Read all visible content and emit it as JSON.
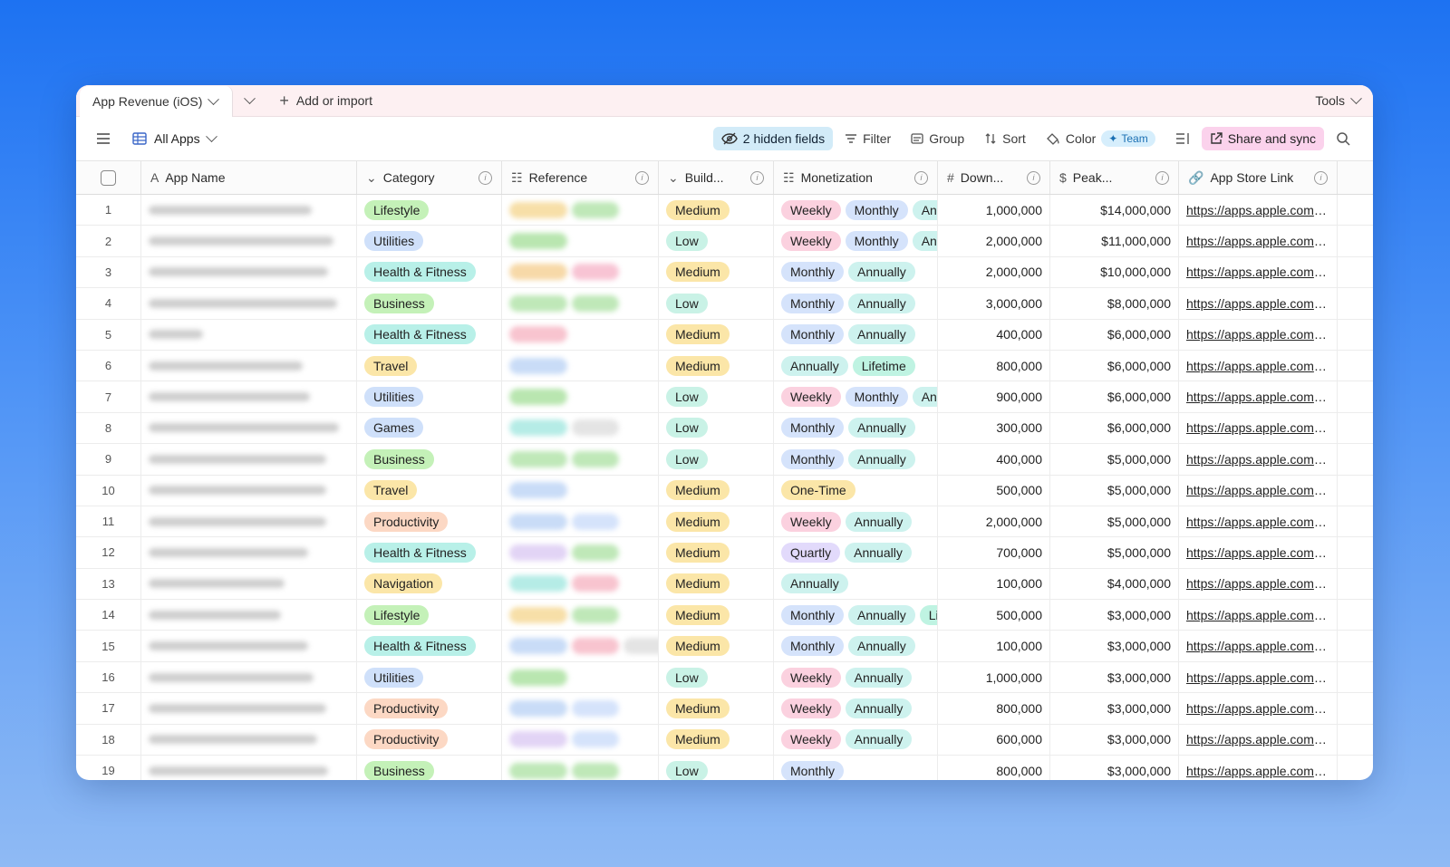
{
  "topbar": {
    "base_name": "App Revenue (iOS)",
    "add_label": "Add or import",
    "tools_label": "Tools"
  },
  "toolbar": {
    "view_name": "All Apps",
    "hidden_fields": "2 hidden fields",
    "filter": "Filter",
    "group": "Group",
    "sort": "Sort",
    "color": "Color",
    "team_badge": "Team",
    "share": "Share and sync"
  },
  "columns": [
    {
      "label": "App Name",
      "icon": "text-field-icon"
    },
    {
      "label": "Category",
      "icon": "single-select-icon"
    },
    {
      "label": "Reference",
      "icon": "linked-record-icon"
    },
    {
      "label": "Build...",
      "icon": "single-select-icon"
    },
    {
      "label": "Monetization",
      "icon": "multi-select-icon"
    },
    {
      "label": "Down...",
      "icon": "number-icon"
    },
    {
      "label": "Peak...",
      "icon": "currency-icon"
    },
    {
      "label": "App Store Link",
      "icon": "link-icon"
    }
  ],
  "colors": {
    "category": {
      "Lifestyle": "#c4f1b8",
      "Utilities": "#cfe0fa",
      "Health & Fitness": "#b8f0e8",
      "Business": "#c4f1b8",
      "Travel": "#fbe6a8",
      "Games": "#cfe0fa",
      "Productivity": "#fcd8c4",
      "Navigation": "#fbe6a8"
    },
    "build": {
      "Medium": "#fbe6a8",
      "Low": "#c9f2e6"
    },
    "monetization": {
      "Weekly": "#fbd1df",
      "Monthly": "#d5e3fb",
      "Annually": "#cdf2ee",
      "Lifetime": "#bff3e2",
      "One-Time": "#fbe6a8",
      "Quartly": "#e2dafb",
      "Ann": "#cdf2ee",
      "Li": "#bff3e2"
    }
  },
  "rows": [
    {
      "n": "1",
      "category": "Lifestyle",
      "build": "Medium",
      "monetization": [
        "Weekly",
        "Monthly",
        "Ann"
      ],
      "downloads": "1,000,000",
      "peak": "$14,000,000",
      "link": "https://apps.apple.com/U...",
      "ref": [
        "#f7dfa8",
        "#bfe8b8"
      ]
    },
    {
      "n": "2",
      "category": "Utilities",
      "build": "Low",
      "monetization": [
        "Weekly",
        "Monthly",
        "Ann"
      ],
      "downloads": "2,000,000",
      "peak": "$11,000,000",
      "link": "https://apps.apple.com/U...",
      "ref": [
        "#b9e6b0"
      ]
    },
    {
      "n": "3",
      "category": "Health & Fitness",
      "build": "Medium",
      "monetization": [
        "Monthly",
        "Annually"
      ],
      "downloads": "2,000,000",
      "peak": "$10,000,000",
      "link": "https://apps.apple.com/U...",
      "ref": [
        "#f7d9a8",
        "#f8c4d4"
      ]
    },
    {
      "n": "4",
      "category": "Business",
      "build": "Low",
      "monetization": [
        "Monthly",
        "Annually"
      ],
      "downloads": "3,000,000",
      "peak": "$8,000,000",
      "link": "https://apps.apple.com/U...",
      "ref": [
        "#bfe8b8",
        "#bfe8b8"
      ]
    },
    {
      "n": "5",
      "category": "Health & Fitness",
      "build": "Medium",
      "monetization": [
        "Monthly",
        "Annually"
      ],
      "downloads": "400,000",
      "peak": "$6,000,000",
      "link": "https://apps.apple.com/U...",
      "ref": [
        "#f8c4cf"
      ]
    },
    {
      "n": "6",
      "category": "Travel",
      "build": "Medium",
      "monetization": [
        "Annually",
        "Lifetime"
      ],
      "downloads": "800,000",
      "peak": "$6,000,000",
      "link": "https://apps.apple.com/U...",
      "ref": [
        "#c9dcf7"
      ]
    },
    {
      "n": "7",
      "category": "Utilities",
      "build": "Low",
      "monetization": [
        "Weekly",
        "Monthly",
        "Ann"
      ],
      "downloads": "900,000",
      "peak": "$6,000,000",
      "link": "https://apps.apple.com/U...",
      "ref": [
        "#b9e6b0"
      ]
    },
    {
      "n": "8",
      "category": "Games",
      "build": "Low",
      "monetization": [
        "Monthly",
        "Annually"
      ],
      "downloads": "300,000",
      "peak": "$6,000,000",
      "link": "https://apps.apple.com/U...",
      "ref": [
        "#b5ece6",
        "#e4e4e4"
      ]
    },
    {
      "n": "9",
      "category": "Business",
      "build": "Low",
      "monetization": [
        "Monthly",
        "Annually"
      ],
      "downloads": "400,000",
      "peak": "$5,000,000",
      "link": "https://apps.apple.com/U...",
      "ref": [
        "#bfe8b8",
        "#bfe8b8"
      ]
    },
    {
      "n": "10",
      "category": "Travel",
      "build": "Medium",
      "monetization": [
        "One-Time"
      ],
      "downloads": "500,000",
      "peak": "$5,000,000",
      "link": "https://apps.apple.com/U...",
      "ref": [
        "#c9dcf7"
      ]
    },
    {
      "n": "11",
      "category": "Productivity",
      "build": "Medium",
      "monetization": [
        "Weekly",
        "Annually"
      ],
      "downloads": "2,000,000",
      "peak": "$5,000,000",
      "link": "https://apps.apple.com/U...",
      "ref": [
        "#c9dcf7",
        "#d5e3fb"
      ]
    },
    {
      "n": "12",
      "category": "Health & Fitness",
      "build": "Medium",
      "monetization": [
        "Quartly",
        "Annually"
      ],
      "downloads": "700,000",
      "peak": "$5,000,000",
      "link": "https://apps.apple.com/D...",
      "ref": [
        "#e2d4f5",
        "#bfe8b8"
      ]
    },
    {
      "n": "13",
      "category": "Navigation",
      "build": "Medium",
      "monetization": [
        "Annually"
      ],
      "downloads": "100,000",
      "peak": "$4,000,000",
      "link": "https://apps.apple.com/U...",
      "ref": [
        "#b5ece6",
        "#f8c4cf"
      ]
    },
    {
      "n": "14",
      "category": "Lifestyle",
      "build": "Medium",
      "monetization": [
        "Monthly",
        "Annually",
        "Li"
      ],
      "downloads": "500,000",
      "peak": "$3,000,000",
      "link": "https://apps.apple.com/U...",
      "ref": [
        "#f7dfa8",
        "#bfe8b8"
      ]
    },
    {
      "n": "15",
      "category": "Health & Fitness",
      "build": "Medium",
      "monetization": [
        "Monthly",
        "Annually"
      ],
      "downloads": "100,000",
      "peak": "$3,000,000",
      "link": "https://apps.apple.com/U...",
      "ref": [
        "#c9dcf7",
        "#f8c4cf",
        "#e4e4e4"
      ]
    },
    {
      "n": "16",
      "category": "Utilities",
      "build": "Low",
      "monetization": [
        "Weekly",
        "Annually"
      ],
      "downloads": "1,000,000",
      "peak": "$3,000,000",
      "link": "https://apps.apple.com/U...",
      "ref": [
        "#b9e6b0"
      ]
    },
    {
      "n": "17",
      "category": "Productivity",
      "build": "Medium",
      "monetization": [
        "Weekly",
        "Annually"
      ],
      "downloads": "800,000",
      "peak": "$3,000,000",
      "link": "https://apps.apple.com/U...",
      "ref": [
        "#c9dcf7",
        "#d5e3fb"
      ]
    },
    {
      "n": "18",
      "category": "Productivity",
      "build": "Medium",
      "monetization": [
        "Weekly",
        "Annually"
      ],
      "downloads": "600,000",
      "peak": "$3,000,000",
      "link": "https://apps.apple.com/U...",
      "ref": [
        "#e2d4f5",
        "#d5e3fb"
      ]
    },
    {
      "n": "19",
      "category": "Business",
      "build": "Low",
      "monetization": [
        "Monthly"
      ],
      "downloads": "800,000",
      "peak": "$3,000,000",
      "link": "https://apps.apple.com/U...",
      "ref": [
        "#bfe8b8",
        "#bfe8b8"
      ]
    }
  ]
}
